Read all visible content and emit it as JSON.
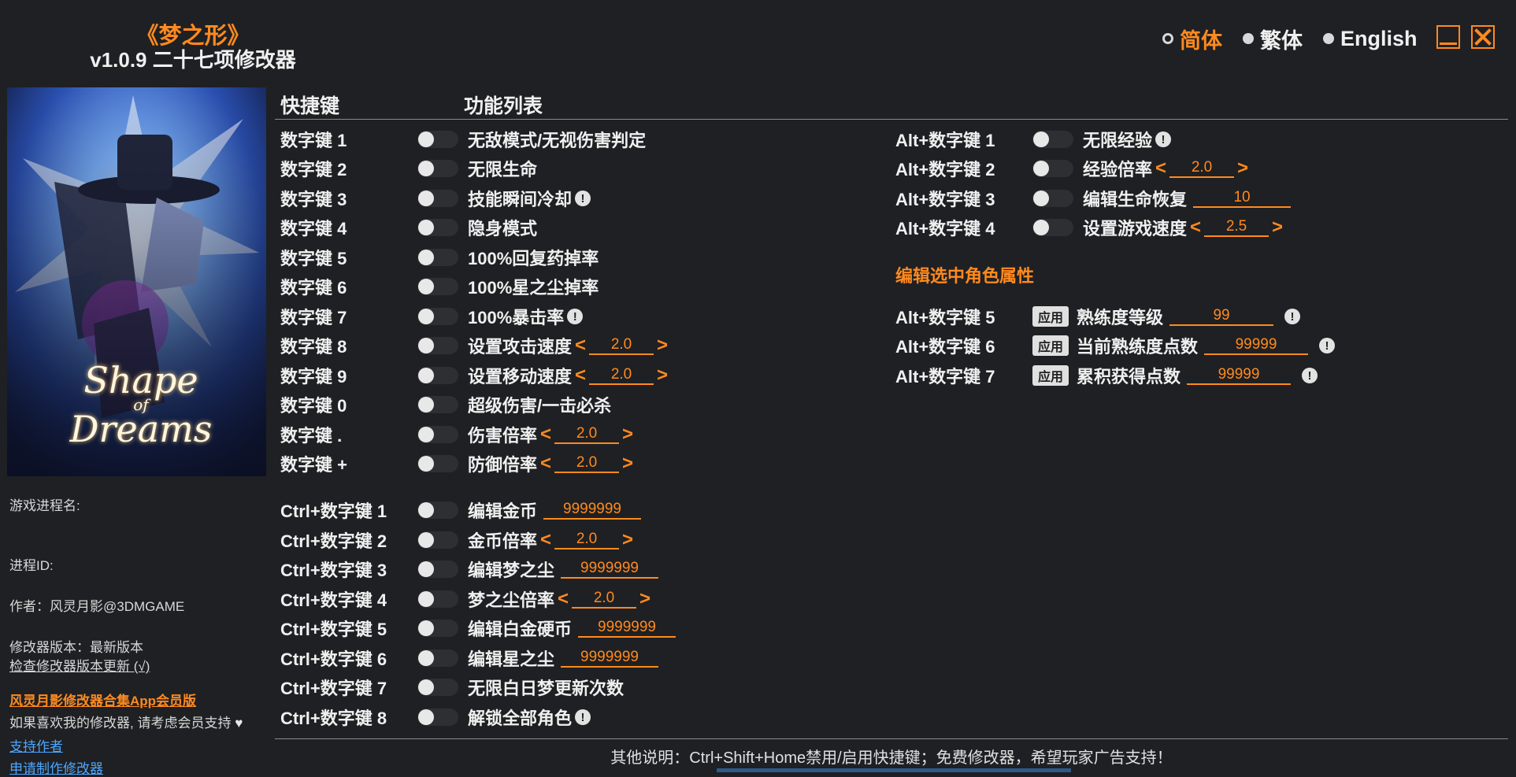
{
  "header": {
    "title": "《梦之形》",
    "subtitle": "v1.0.9 二十七项修改器",
    "languages": [
      "简体",
      "繁体",
      "English"
    ],
    "active_language": "简体"
  },
  "cover": {
    "logo_line1": "Shape",
    "logo_line2": "of",
    "logo_line3": "Dreams"
  },
  "info": {
    "process_name_label": "游戏进程名:",
    "process_id_label": "进程ID:",
    "author": "作者：风灵月影@3DMGAME",
    "version": "修改器版本：最新版本",
    "check_update": "检查修改器版本更新 (√)",
    "app_promo": "风灵月影修改器合集App会员版",
    "support_text": "如果喜欢我的修改器, 请考虑会员支持",
    "heart": "♥",
    "support_author": "支持作者",
    "request_trainer": "申请制作修改器"
  },
  "table": {
    "col_hotkey": "快捷键",
    "col_features": "功能列表",
    "left_rows": [
      {
        "key": "数字键 1",
        "label": "无敌模式/无视伤害判定"
      },
      {
        "key": "数字键 2",
        "label": "无限生命"
      },
      {
        "key": "数字键 3",
        "label": "技能瞬间冷却",
        "warn": "!"
      },
      {
        "key": "数字键 4",
        "label": "隐身模式"
      },
      {
        "key": "数字键 5",
        "label": "100%回复药掉率"
      },
      {
        "key": "数字键 6",
        "label": "100%星之尘掉率"
      },
      {
        "key": "数字键 7",
        "label": "100%暴击率",
        "warn": "!"
      },
      {
        "key": "数字键 8",
        "label": "设置攻击速度",
        "value": "2.0",
        "arrows": true
      },
      {
        "key": "数字键 9",
        "label": "设置移动速度",
        "value": "2.0",
        "arrows": true
      },
      {
        "key": "数字键 0",
        "label": "超级伤害/一击必杀"
      },
      {
        "key": "数字键 .",
        "label": "伤害倍率",
        "value": "2.0",
        "arrows": true
      },
      {
        "key": "数字键 +",
        "label": "防御倍率",
        "value": "2.0",
        "arrows": true
      },
      {
        "key": "Ctrl+数字键 1",
        "label": "编辑金币",
        "value": "9999999"
      },
      {
        "key": "Ctrl+数字键 2",
        "label": "金币倍率",
        "value": "2.0",
        "arrows": true
      },
      {
        "key": "Ctrl+数字键 3",
        "label": "编辑梦之尘",
        "value": "9999999"
      },
      {
        "key": "Ctrl+数字键 4",
        "label": "梦之尘倍率",
        "value": "2.0",
        "arrows": true
      },
      {
        "key": "Ctrl+数字键 5",
        "label": "编辑白金硬币",
        "value": "9999999"
      },
      {
        "key": "Ctrl+数字键 6",
        "label": "编辑星之尘",
        "value": "9999999"
      },
      {
        "key": "Ctrl+数字键 7",
        "label": "无限白日梦更新次数"
      },
      {
        "key": "Ctrl+数字键 8",
        "label": "解锁全部角色",
        "warn": "!"
      }
    ],
    "right_rows": [
      {
        "key": "Alt+数字键 1",
        "label": "无限经验",
        "warn": "!"
      },
      {
        "key": "Alt+数字键 2",
        "label": "经验倍率",
        "value": "2.0",
        "arrows": true
      },
      {
        "key": "Alt+数字键 3",
        "label": "编辑生命恢复",
        "value": "10"
      },
      {
        "key": "Alt+数字键 4",
        "label": "设置游戏速度",
        "value": "2.5",
        "arrows": true
      }
    ],
    "section_heading": "编辑选中角色属性",
    "apply_rows": [
      {
        "key": "Alt+数字键 5",
        "button": "应用",
        "label": "熟练度等级",
        "value": "99",
        "warn": "!"
      },
      {
        "key": "Alt+数字键 6",
        "button": "应用",
        "label": "当前熟练度点数",
        "value": "99999",
        "warn": "!"
      },
      {
        "key": "Alt+数字键 7",
        "button": "应用",
        "label": "累积获得点数",
        "value": "99999",
        "warn": "!"
      }
    ],
    "arrow_left": "<",
    "arrow_right": ">"
  },
  "footer": {
    "note": "其他说明：Ctrl+Shift+Home禁用/启用快捷键；免费修改器，希望玩家广告支持！"
  },
  "colors": {
    "accent": "#ff8a1f",
    "background": "#1f2023",
    "link": "#4da6ff"
  }
}
